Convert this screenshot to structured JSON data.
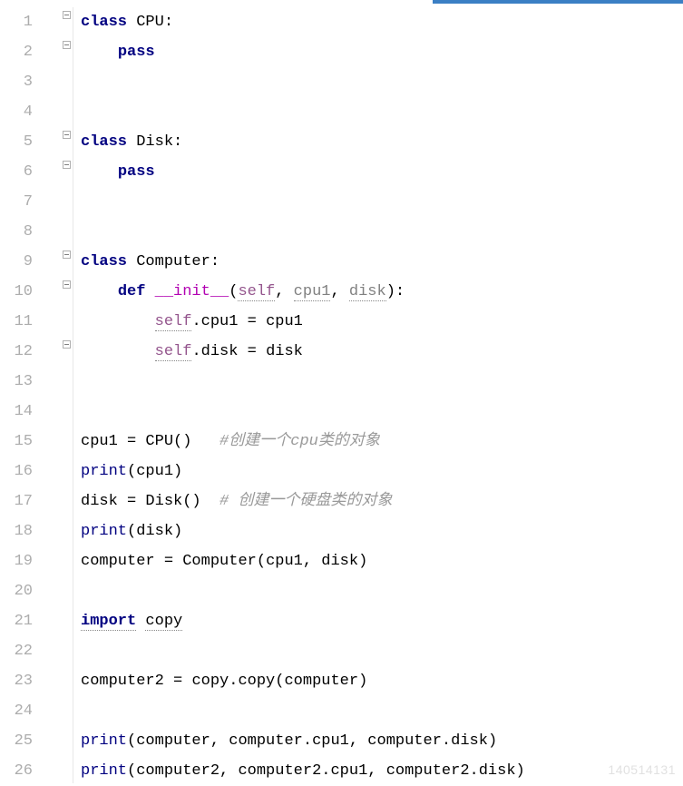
{
  "lineNumbers": [
    "1",
    "2",
    "3",
    "4",
    "5",
    "6",
    "7",
    "8",
    "9",
    "10",
    "11",
    "12",
    "13",
    "14",
    "15",
    "16",
    "17",
    "18",
    "19",
    "20",
    "21",
    "22",
    "23",
    "24",
    "25",
    "26"
  ],
  "code": {
    "l1": {
      "kw_class": "class",
      "name": "CPU",
      "colon": ":"
    },
    "l2": {
      "indent": "    ",
      "kw": "pass"
    },
    "l5": {
      "kw_class": "class",
      "name": "Disk",
      "colon": ":"
    },
    "l6": {
      "indent": "    ",
      "kw": "pass"
    },
    "l9": {
      "kw_class": "class",
      "name": "Computer",
      "colon": ":"
    },
    "l10": {
      "indent": "    ",
      "kw_def": "def",
      "dunder": "__init__",
      "lp": "(",
      "self": "self",
      "c1": ", ",
      "p1": "cpu1",
      "c2": ", ",
      "p2": "disk",
      "rp": ")",
      "colon": ":"
    },
    "l11": {
      "indent": "        ",
      "self": "self",
      "dot": ".",
      "attr": "cpu1",
      "eq": " = ",
      "val": "cpu1"
    },
    "l12": {
      "indent": "        ",
      "self": "self",
      "dot": ".",
      "attr": "disk",
      "eq": " = ",
      "val": "disk"
    },
    "l15": {
      "var": "cpu1",
      "eq": " = ",
      "cls": "CPU",
      "call": "()",
      "sp": "   ",
      "comment": "#创建一个cpu类的对象"
    },
    "l16": {
      "fn": "print",
      "lp": "(",
      "arg": "cpu1",
      "rp": ")"
    },
    "l17": {
      "var": "disk",
      "eq": " = ",
      "cls": "Disk",
      "call": "()",
      "sp": "  ",
      "comment": "# 创建一个硬盘类的对象"
    },
    "l18": {
      "fn": "print",
      "lp": "(",
      "arg": "disk",
      "rp": ")"
    },
    "l19": {
      "var": "computer",
      "eq": " = ",
      "cls": "Computer",
      "lp": "(",
      "a1": "cpu1",
      "c": ", ",
      "a2": "disk",
      "rp": ")"
    },
    "l21": {
      "kw": "import",
      "sp": " ",
      "mod": "copy"
    },
    "l23": {
      "var": "computer2",
      "eq": " = ",
      "mod": "copy",
      "dot": ".",
      "fn": "copy",
      "lp": "(",
      "arg": "computer",
      "rp": ")"
    },
    "l25": {
      "fn": "print",
      "lp": "(",
      "a1": "computer",
      "c1": ", ",
      "a2a": "computer",
      "d2": ".",
      "a2b": "cpu1",
      "c2": ", ",
      "a3a": "computer",
      "d3": ".",
      "a3b": "disk",
      "rp": ")"
    },
    "l26": {
      "fn": "print",
      "lp": "(",
      "a1": "computer2",
      "c1": ", ",
      "a2a": "computer2",
      "d2": ".",
      "a2b": "cpu1",
      "c2": ", ",
      "a3a": "computer2",
      "d3": ".",
      "a3b": "disk",
      "rp": ")"
    }
  },
  "watermark": "140514131"
}
